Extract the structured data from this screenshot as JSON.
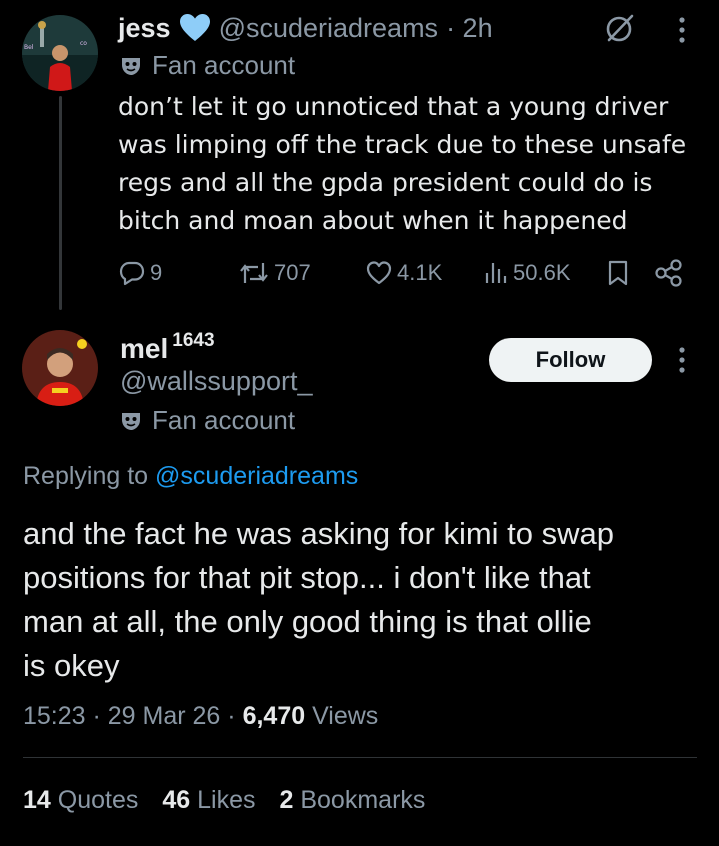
{
  "tweet1": {
    "display_name": "jess",
    "handle": "@scuderiadreams",
    "time": "· 2h",
    "fan_label": "Fan account",
    "text_lines": [
      "don’t let it go unnoticed that a young driver",
      "was limping off the track due to these unsafe",
      "regs and all the gpda president could do is",
      "bitch and moan about when it happened"
    ],
    "replies": "9",
    "reposts": "707",
    "likes": "4.1K",
    "views": "50.6K",
    "badge_color": "#8ecdf8"
  },
  "tweet2": {
    "display_name": "mel",
    "name_suffix": "1643",
    "handle": "@wallssupport_",
    "fan_label": "Fan account",
    "follow_label": "Follow",
    "replying_prefix": "Replying to",
    "replying_handle": "@scuderiadreams",
    "text_lines": [
      "and the fact he was asking for kimi to swap",
      "positions for that pit stop... i don't like that",
      "man at all, the only good thing is that ollie",
      "is okey"
    ],
    "time": "15:23 · 29 Mar 26 · ",
    "views_count": "6,470",
    "views_label": " Views",
    "quotes_count": "14",
    "quotes_label": " Quotes",
    "likes_count": "46",
    "likes_label": " Likes",
    "bookmarks_count": "2",
    "bookmarks_label": " Bookmarks"
  },
  "colors": {
    "background": "#000000",
    "text": "#e7e9ea",
    "muted": "#8b98a5",
    "link": "#1d9bf0"
  }
}
